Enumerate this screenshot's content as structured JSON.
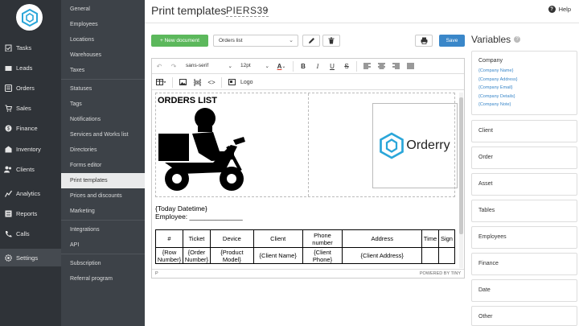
{
  "nav": {
    "items": [
      {
        "label": "Tasks",
        "icon": "clipboard-check-icon"
      },
      {
        "label": "Leads",
        "icon": "leads-icon"
      },
      {
        "label": "Orders",
        "icon": "orders-icon"
      },
      {
        "label": "Sales",
        "icon": "cart-icon"
      },
      {
        "label": "Finance",
        "icon": "finance-icon"
      },
      {
        "label": "Inventory",
        "icon": "inventory-icon"
      },
      {
        "label": "Clients",
        "icon": "clients-icon"
      },
      {
        "label": "Analytics",
        "icon": "analytics-icon"
      },
      {
        "label": "Reports",
        "icon": "reports-icon"
      },
      {
        "label": "Calls",
        "icon": "phone-icon"
      },
      {
        "label": "Settings",
        "icon": "gear-icon",
        "active": true
      }
    ]
  },
  "subnav": {
    "items": [
      {
        "label": "General"
      },
      {
        "label": "Employees"
      },
      {
        "label": "Locations"
      },
      {
        "label": "Warehouses"
      },
      {
        "label": "Taxes"
      },
      {
        "label": "Statuses"
      },
      {
        "label": "Tags"
      },
      {
        "label": "Notifications"
      },
      {
        "label": "Services and Works list"
      },
      {
        "label": "Directories"
      },
      {
        "label": "Forms editor"
      },
      {
        "label": "Print templates",
        "active": true
      },
      {
        "label": "Prices and discounts"
      },
      {
        "label": "Marketing"
      },
      {
        "label": "Integrations"
      },
      {
        "label": "API"
      },
      {
        "label": "Subscription"
      },
      {
        "label": "Referral program"
      }
    ]
  },
  "header": {
    "title": "Print templates",
    "subtitle": "PIERS39",
    "help_label": "Help"
  },
  "toolbar": {
    "new_document_label": "+ New document",
    "template_select_value": "Orders list",
    "save_label": "Save"
  },
  "editor": {
    "font_family": "sans-serif",
    "font_size": "12pt",
    "logo_button_label": "Logo",
    "status_path": "P",
    "powered_by": "POWERED BY TINY",
    "document": {
      "heading": "ORDERS LIST",
      "company_logo_text": "Orderry",
      "datetime_var": "{Today Datetime}",
      "employee_line": "Employee: ______________",
      "table_headers": [
        "#",
        "Ticket",
        "Device",
        "Client",
        "Phone number",
        "Address",
        "Time",
        "Sign"
      ],
      "table_row": [
        "{Row Number}",
        "{Order Number}",
        "{Product Model}",
        "{Client Name}",
        "{Client Phone}",
        "{Client Address}",
        "",
        ""
      ]
    }
  },
  "variables": {
    "title": "Variables",
    "company": {
      "label": "Company",
      "links": [
        "{Company Name}",
        "{Company Address}",
        "{Company Email}",
        "{Company Details}",
        "{Company Note}"
      ]
    },
    "groups": [
      "Client",
      "Order",
      "Asset",
      "Tables",
      "Employees",
      "Finance",
      "Date",
      "Other"
    ]
  },
  "colors": {
    "nav_bg": "#2f3338",
    "subnav_bg": "#3d4248",
    "primary": "#3a87c9",
    "success": "#5cb85c",
    "brand": "#2aa6d9"
  }
}
